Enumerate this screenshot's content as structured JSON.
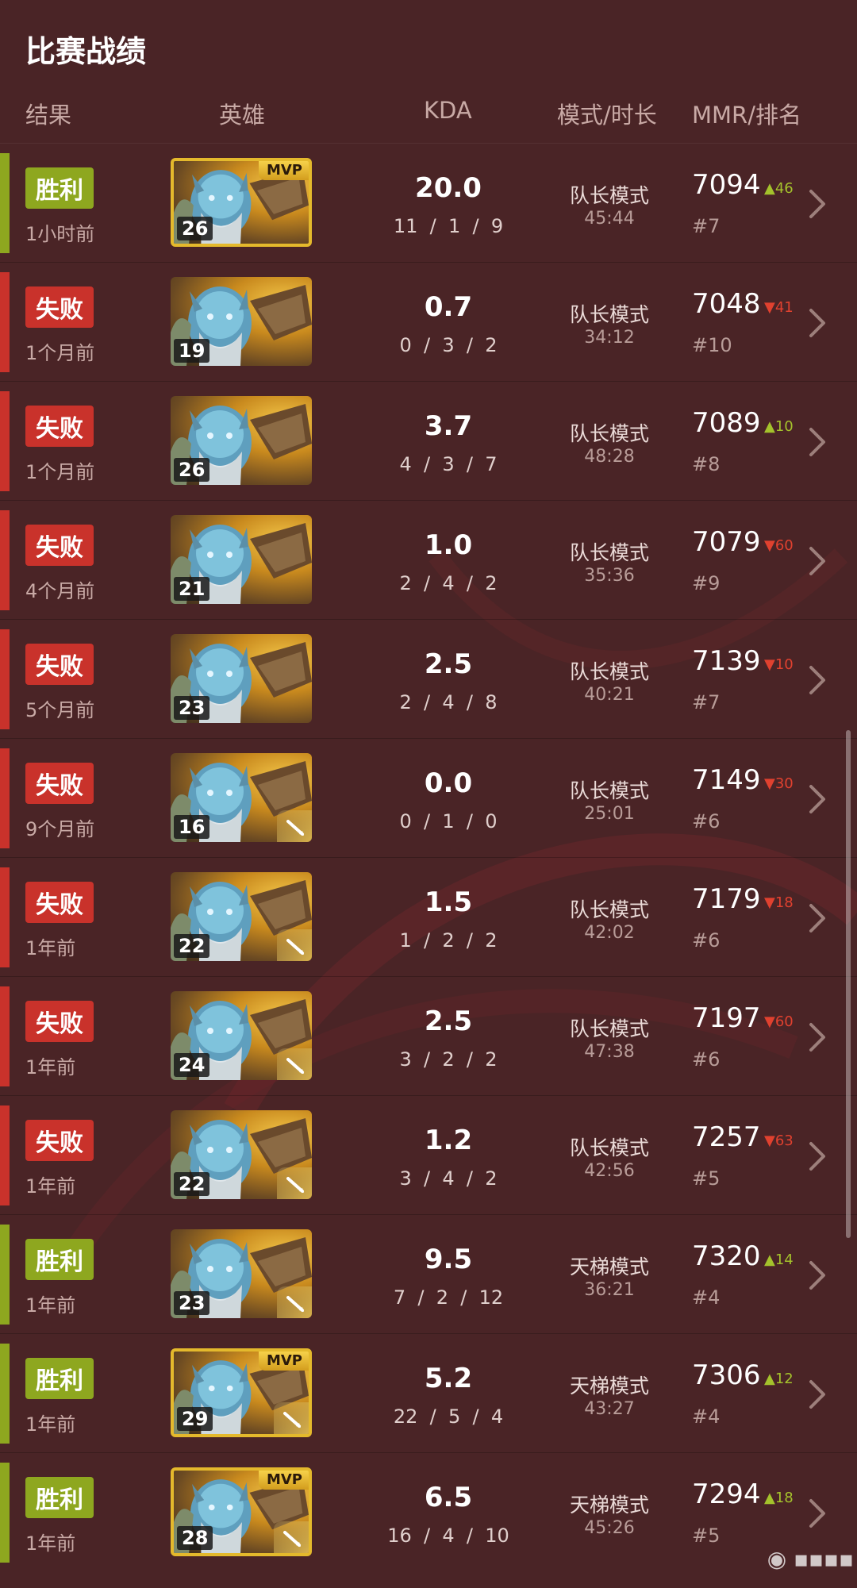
{
  "page_title": "比赛战绩",
  "headers": {
    "result": "结果",
    "hero": "英雄",
    "kda": "KDA",
    "mode": "模式/时长",
    "mmr": "MMR/排名"
  },
  "colors": {
    "background": "#4a2426",
    "win": "#8ea71f",
    "loss": "#c9322b",
    "mvp_border": "#e4b92c"
  },
  "matches": [
    {
      "result": "胜利",
      "outcome": "win",
      "time_ago": "1小时前",
      "hero_icon": "hero-portrait-icon",
      "level": "26",
      "mvp": true,
      "mvp_label": "MVP",
      "item": false,
      "kda": "20.0",
      "k": "11",
      "d": "1",
      "a": "9",
      "mode": "队长模式",
      "duration": "45:44",
      "mmr": "7094",
      "delta": "46",
      "delta_dir": "up",
      "rank": "#7"
    },
    {
      "result": "失败",
      "outcome": "loss",
      "time_ago": "1个月前",
      "hero_icon": "hero-portrait-icon",
      "level": "19",
      "mvp": false,
      "item": false,
      "kda": "0.7",
      "k": "0",
      "d": "3",
      "a": "2",
      "mode": "队长模式",
      "duration": "34:12",
      "mmr": "7048",
      "delta": "41",
      "delta_dir": "down",
      "rank": "#10"
    },
    {
      "result": "失败",
      "outcome": "loss",
      "time_ago": "1个月前",
      "hero_icon": "hero-portrait-icon",
      "level": "26",
      "mvp": false,
      "item": false,
      "kda": "3.7",
      "k": "4",
      "d": "3",
      "a": "7",
      "mode": "队长模式",
      "duration": "48:28",
      "mmr": "7089",
      "delta": "10",
      "delta_dir": "up",
      "rank": "#8"
    },
    {
      "result": "失败",
      "outcome": "loss",
      "time_ago": "4个月前",
      "hero_icon": "hero-portrait-icon",
      "level": "21",
      "mvp": false,
      "item": false,
      "kda": "1.0",
      "k": "2",
      "d": "4",
      "a": "2",
      "mode": "队长模式",
      "duration": "35:36",
      "mmr": "7079",
      "delta": "60",
      "delta_dir": "down",
      "rank": "#9"
    },
    {
      "result": "失败",
      "outcome": "loss",
      "time_ago": "5个月前",
      "hero_icon": "hero-portrait-icon",
      "level": "23",
      "mvp": false,
      "item": false,
      "kda": "2.5",
      "k": "2",
      "d": "4",
      "a": "8",
      "mode": "队长模式",
      "duration": "40:21",
      "mmr": "7139",
      "delta": "10",
      "delta_dir": "down",
      "rank": "#7"
    },
    {
      "result": "失败",
      "outcome": "loss",
      "time_ago": "9个月前",
      "hero_icon": "hero-portrait-icon",
      "level": "16",
      "mvp": false,
      "item": true,
      "kda": "0.0",
      "k": "0",
      "d": "1",
      "a": "0",
      "mode": "队长模式",
      "duration": "25:01",
      "mmr": "7149",
      "delta": "30",
      "delta_dir": "down",
      "rank": "#6"
    },
    {
      "result": "失败",
      "outcome": "loss",
      "time_ago": "1年前",
      "hero_icon": "hero-portrait-icon",
      "level": "22",
      "mvp": false,
      "item": true,
      "kda": "1.5",
      "k": "1",
      "d": "2",
      "a": "2",
      "mode": "队长模式",
      "duration": "42:02",
      "mmr": "7179",
      "delta": "18",
      "delta_dir": "down",
      "rank": "#6"
    },
    {
      "result": "失败",
      "outcome": "loss",
      "time_ago": "1年前",
      "hero_icon": "hero-portrait-icon",
      "level": "24",
      "mvp": false,
      "item": true,
      "kda": "2.5",
      "k": "3",
      "d": "2",
      "a": "2",
      "mode": "队长模式",
      "duration": "47:38",
      "mmr": "7197",
      "delta": "60",
      "delta_dir": "down",
      "rank": "#6"
    },
    {
      "result": "失败",
      "outcome": "loss",
      "time_ago": "1年前",
      "hero_icon": "hero-portrait-icon",
      "level": "22",
      "mvp": false,
      "item": true,
      "kda": "1.2",
      "k": "3",
      "d": "4",
      "a": "2",
      "mode": "队长模式",
      "duration": "42:56",
      "mmr": "7257",
      "delta": "63",
      "delta_dir": "down",
      "rank": "#5"
    },
    {
      "result": "胜利",
      "outcome": "win",
      "time_ago": "1年前",
      "hero_icon": "hero-portrait-icon",
      "level": "23",
      "mvp": false,
      "item": true,
      "kda": "9.5",
      "k": "7",
      "d": "2",
      "a": "12",
      "mode": "天梯模式",
      "duration": "36:21",
      "mmr": "7320",
      "delta": "14",
      "delta_dir": "up",
      "rank": "#4"
    },
    {
      "result": "胜利",
      "outcome": "win",
      "time_ago": "1年前",
      "hero_icon": "hero-portrait-icon",
      "level": "29",
      "mvp": true,
      "mvp_label": "MVP",
      "item": true,
      "kda": "5.2",
      "k": "22",
      "d": "5",
      "a": "4",
      "mode": "天梯模式",
      "duration": "43:27",
      "mmr": "7306",
      "delta": "12",
      "delta_dir": "up",
      "rank": "#4"
    },
    {
      "result": "胜利",
      "outcome": "win",
      "time_ago": "1年前",
      "hero_icon": "hero-portrait-icon",
      "level": "28",
      "mvp": true,
      "mvp_label": "MVP",
      "item": true,
      "kda": "6.5",
      "k": "16",
      "d": "4",
      "a": "10",
      "mode": "天梯模式",
      "duration": "45:26",
      "mmr": "7294",
      "delta": "18",
      "delta_dir": "up",
      "rank": "#5"
    }
  ]
}
